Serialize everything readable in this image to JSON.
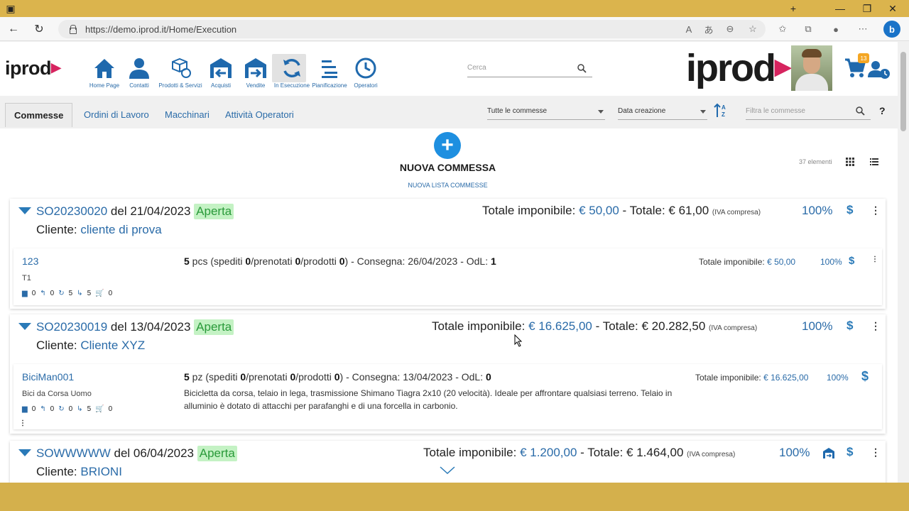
{
  "browser": {
    "url": "https://demo.iprod.it/Home/Execution",
    "titlebar_buttons": [
      "+",
      "—",
      "❐",
      "✕"
    ]
  },
  "header": {
    "logo_small": "iprod",
    "logo_big": "iprod",
    "nav": [
      {
        "label": "Home Page",
        "icon": "home-icon"
      },
      {
        "label": "Contatti",
        "icon": "person-icon"
      },
      {
        "label": "Prodotti & Servizi",
        "icon": "boxes-icon"
      },
      {
        "label": "Acquisti",
        "icon": "warehouse-in-icon"
      },
      {
        "label": "Vendite",
        "icon": "warehouse-out-icon"
      },
      {
        "label": "In Esecuzione",
        "icon": "refresh-icon",
        "active": true
      },
      {
        "label": "Pianificazione",
        "icon": "list-lines-icon"
      },
      {
        "label": "Operatori",
        "icon": "clock-icon"
      }
    ],
    "search_placeholder": "Cerca",
    "cart_badge": "13"
  },
  "toolbar": {
    "tabs": [
      "Commesse",
      "Ordini di Lavoro",
      "Macchinari",
      "Attività Operatori"
    ],
    "filter_all": "Tutte le commesse",
    "sort_by": "Data creazione",
    "filter_placeholder": "Filtra le commesse",
    "help": "?"
  },
  "newpanel": {
    "plus": "+",
    "title": "NUOVA COMMESSA",
    "list_link": "NUOVA LISTA COMMESSE",
    "count": "37 elementi"
  },
  "orders": [
    {
      "code": "SO20230020",
      "date": " del 21/04/2023 ",
      "status": "Aperta",
      "client_label": "Cliente: ",
      "client": "cliente di prova",
      "totals": {
        "imponibile_label": "Totale imponibile: ",
        "imponibile": "€ 50,00",
        "totale_label": " - Totale: € 61,00 ",
        "iva": "(IVA compresa)"
      },
      "pct": "100%",
      "line": {
        "code": "123",
        "desc": "T1",
        "icons": [
          "0",
          "0",
          "5",
          "5",
          "0"
        ],
        "qty_num": "5",
        "qty_unit": " pcs (spediti ",
        "spediti": "0",
        "prenotati_label": "/prenotati ",
        "prenotati": "0",
        "prodotti_label": "/prodotti ",
        "prodotti": "0",
        "consegna": ") - Consegna: 26/04/2023 - OdL: ",
        "odl": "1",
        "tot_label": "Totale imponibile: ",
        "tot": "€ 50,00",
        "pct": "100%"
      }
    },
    {
      "code": "SO20230019",
      "date": " del 13/04/2023 ",
      "status": "Aperta",
      "client_label": "Cliente: ",
      "client": "Cliente XYZ",
      "totals": {
        "imponibile_label": "Totale imponibile: ",
        "imponibile": "€ 16.625,00",
        "totale_label": " - Totale: € 20.282,50 ",
        "iva": "(IVA compresa)"
      },
      "pct": "100%",
      "line": {
        "code": "BiciMan001",
        "desc": "Bici da Corsa Uomo",
        "icons": [
          "0",
          "0",
          "0",
          "5",
          "0"
        ],
        "qty_num": "5",
        "qty_unit": " pz (spediti ",
        "spediti": "0",
        "prenotati_label": "/prenotati ",
        "prenotati": "0",
        "prodotti_label": "/prodotti ",
        "prodotti": "0",
        "consegna": ") - Consegna: 13/04/2023 - OdL: ",
        "odl": "0",
        "notes": "Bicicletta da corsa, telaio in lega, trasmissione Shimano Tiagra 2x10 (20 velocità). Ideale per affrontare qualsiasi terreno. Telaio in alluminio è dotato di attacchi per parafanghi e di una forcella in carbonio.",
        "tot_label": "Totale imponibile: ",
        "tot": "€ 16.625,00",
        "pct": "100%"
      }
    },
    {
      "code": "SOWWWWW",
      "date": " del 06/04/2023 ",
      "status": "Aperta",
      "client_label": "Cliente: ",
      "client": "BRIONI",
      "totals": {
        "imponibile_label": "Totale imponibile: ",
        "imponibile": "€ 1.200,00",
        "totale_label": " - Totale: € 1.464,00 ",
        "iva": "(IVA compresa)"
      },
      "pct": "100%"
    }
  ],
  "colors": {
    "accent": "#2a6ba8",
    "status_bg": "#c4f2c4",
    "plus_button": "#1e8fe0",
    "badge": "#f4a623"
  }
}
